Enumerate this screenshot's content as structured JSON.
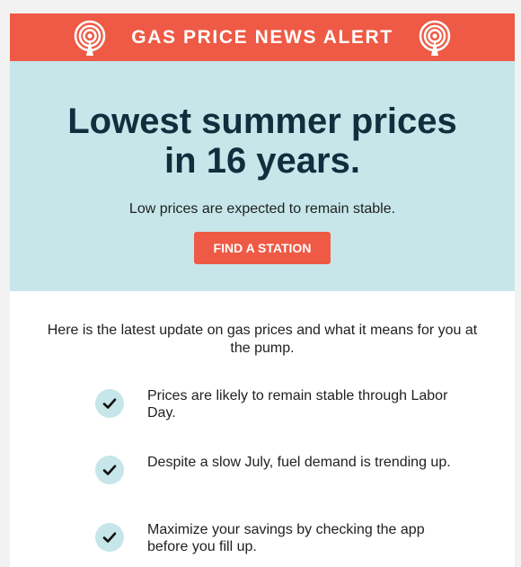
{
  "banner": {
    "title": "GAS PRICE NEWS ALERT",
    "left_icon": "radio-tower-icon",
    "right_icon": "radio-tower-icon"
  },
  "hero": {
    "title_line1": "Lowest summer prices",
    "title_line2": "in 16 years.",
    "subtitle": "Low prices are expected to remain stable.",
    "cta_label": "FIND A STATION"
  },
  "body": {
    "intro": "Here is the latest update on gas prices and what it means for you at the pump.",
    "bullets": [
      {
        "icon": "check-icon",
        "text": "Prices are likely to remain stable through Labor Day."
      },
      {
        "icon": "check-icon",
        "text": "Despite a slow July, fuel demand is trending up."
      },
      {
        "icon": "check-icon",
        "text": "Maximize your savings by checking the app before you fill up."
      }
    ]
  },
  "colors": {
    "accent": "#ee5a45",
    "hero_bg": "#c6e6e9",
    "title_text": "#0f2f3e"
  }
}
